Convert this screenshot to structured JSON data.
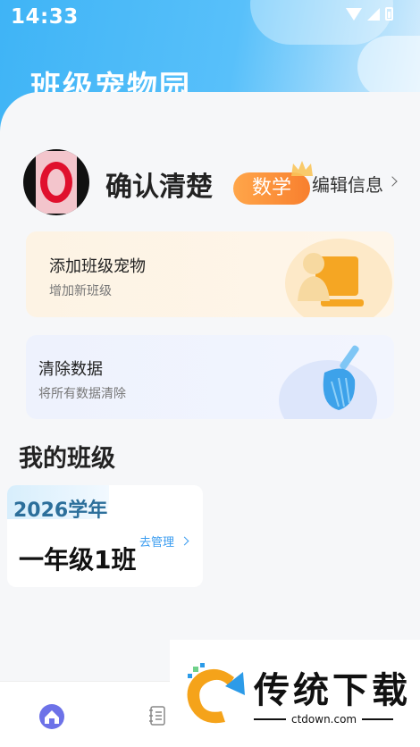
{
  "status_bar": {
    "time": "14:33"
  },
  "header": {
    "title": "班级宠物园"
  },
  "profile": {
    "name": "确认清楚",
    "subject_badge": "数学",
    "edit_label": "编辑信息"
  },
  "cards": {
    "add_pet": {
      "title": "添加班级宠物",
      "subtitle": "增加新班级"
    },
    "clear_data": {
      "title": "清除数据",
      "subtitle": "将所有数据清除"
    }
  },
  "section": {
    "my_classes": "我的班级"
  },
  "classes": [
    {
      "year": "2026学年",
      "name": "一年级1班",
      "manage_label": "去管理"
    }
  ],
  "bottom_nav": {
    "items": [
      "home-icon",
      "notebook-icon"
    ]
  },
  "watermark": {
    "text": "传统下载",
    "url": "ctdown.com"
  },
  "colors": {
    "accent": "#3fb4f6",
    "badge": "#f87f2e",
    "link": "#3a9cf0"
  }
}
